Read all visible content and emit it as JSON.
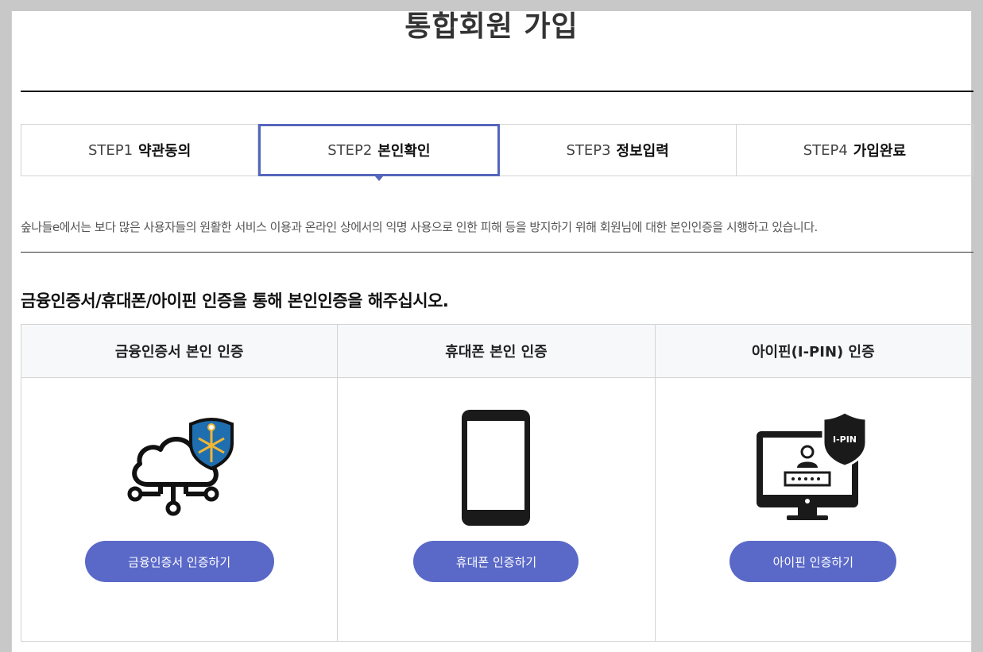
{
  "page": {
    "title": "통합회원 가입"
  },
  "steps": [
    {
      "num": "STEP1",
      "name": "약관동의",
      "active": false
    },
    {
      "num": "STEP2",
      "name": "본인확인",
      "active": true
    },
    {
      "num": "STEP3",
      "name": "정보입력",
      "active": false
    },
    {
      "num": "STEP4",
      "name": "가입완료",
      "active": false
    }
  ],
  "intro": {
    "text": "숲나들e에서는 보다 많은 사용자들의 원활한 서비스 이용과 온라인 상에서의 익명 사용으로 인한 피해 등을 방지하기 위해 회원님에 대한 본인인증을 시행하고 있습니다."
  },
  "section": {
    "heading": "금융인증서/휴대폰/아이핀 인증을 통해 본인인증을 해주십시오."
  },
  "methods": [
    {
      "title": "금융인증서 본인 인증",
      "button": "금융인증서 인증하기",
      "icon": "cloud-certificate-icon"
    },
    {
      "title": "휴대폰 본인 인증",
      "button": "휴대폰 인증하기",
      "icon": "mobile-phone-icon"
    },
    {
      "title": "아이핀(I-PIN) 인증",
      "button": "아이핀 인증하기",
      "icon": "ipin-monitor-icon",
      "badge": "I-PIN"
    }
  ],
  "colors": {
    "accent": "#5a69c8",
    "active_border": "#5566bb",
    "shield_blue": "#1f6fb0",
    "shield_gold": "#f2b632"
  }
}
